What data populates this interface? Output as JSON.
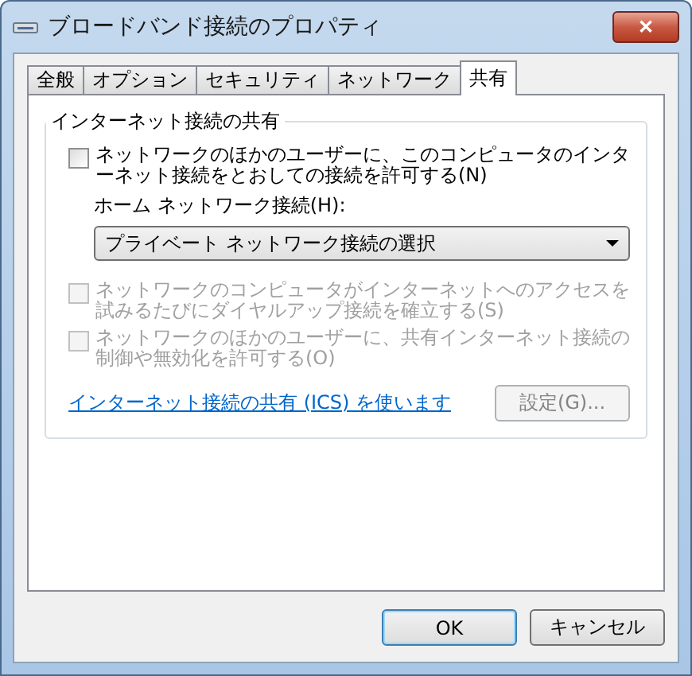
{
  "window": {
    "title": "ブロードバンド接続のプロパティ",
    "close": "✕"
  },
  "tabs": [
    {
      "label": "全般",
      "selected": false
    },
    {
      "label": "オプション",
      "selected": false
    },
    {
      "label": "セキュリティ",
      "selected": false
    },
    {
      "label": "ネットワーク",
      "selected": false
    },
    {
      "label": "共有",
      "selected": true
    }
  ],
  "group": {
    "title": "インターネット接続の共有",
    "options": [
      {
        "label": "ネットワークのほかのユーザーに、このコンピュータのインターネット接続をとおしての接続を許可する(N)",
        "checked": false,
        "disabled": false
      },
      {
        "label": "ネットワークのコンピュータがインターネットへのアクセスを試みるたびにダイヤルアップ接続を確立する(S)",
        "checked": false,
        "disabled": true
      },
      {
        "label": "ネットワークのほかのユーザーに、共有インターネット接続の制御や無効化を許可する(O)",
        "checked": false,
        "disabled": true
      }
    ],
    "home_label": "ホーム ネットワーク接続(H):",
    "home_select": "プライベート ネットワーク接続の選択",
    "link": "インターネット接続の共有 (ICS) を使います",
    "settings_button": {
      "label": "設定(G)...",
      "disabled": true
    }
  },
  "buttons": [
    {
      "label": "OK",
      "selected": true
    },
    {
      "label": "キャンセル",
      "selected": false
    }
  ]
}
